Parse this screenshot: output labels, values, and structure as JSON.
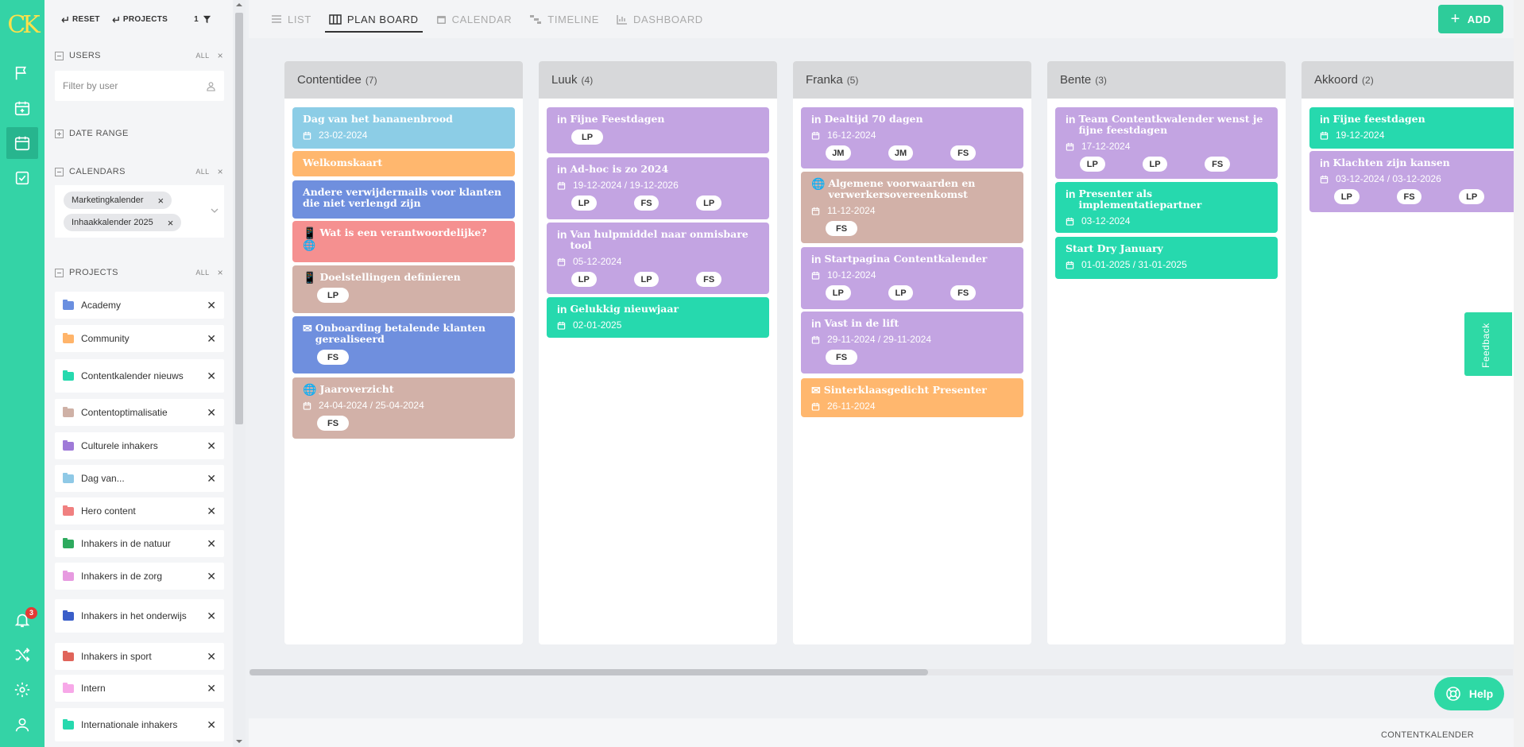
{
  "logo": {
    "text": "CK"
  },
  "rail": {
    "items": [
      {
        "name": "flag-icon"
      },
      {
        "name": "calendar-plus-icon"
      },
      {
        "name": "calendar-icon",
        "active": true
      },
      {
        "name": "check-square-icon"
      }
    ],
    "bottom": [
      {
        "name": "bell-icon",
        "badge": "3"
      },
      {
        "name": "shuffle-icon"
      },
      {
        "name": "settings-icon"
      },
      {
        "name": "user-icon"
      }
    ]
  },
  "sidebar": {
    "reset_label": "RESET",
    "projects_label": "PROJECTS",
    "filter_count": "1",
    "users": {
      "title": "USERS",
      "all": "ALL",
      "x": "×",
      "placeholder": "Filter by user"
    },
    "date_range": {
      "title": "DATE RANGE"
    },
    "calendars": {
      "title": "CALENDARS",
      "all": "ALL",
      "x": "×",
      "chips": [
        "Marketingkalender",
        "Inhaakkalender 2025"
      ],
      "chip_x": "×"
    },
    "projects": {
      "title": "PROJECTS",
      "all": "ALL",
      "x": "×",
      "items": [
        {
          "label": "Academy",
          "color": "#6a8fe0"
        },
        {
          "label": "Community",
          "color": "#ffb46a"
        },
        {
          "label": "Contentkalender nieuws",
          "color": "#26d9ae"
        },
        {
          "label": "Contentoptimalisatie",
          "color": "#cfb1a6"
        },
        {
          "label": "Culturele inhakers",
          "color": "#9f7ad8"
        },
        {
          "label": "Dag van...",
          "color": "#8fc9e6"
        },
        {
          "label": "Hero content",
          "color": "#f08080"
        },
        {
          "label": "Inhakers in de natuur",
          "color": "#2eaa5e"
        },
        {
          "label": "Inhakers in de zorg",
          "color": "#e79ae0"
        },
        {
          "label": "Inhakers in het onderwijs",
          "color": "#3a5ec9"
        },
        {
          "label": "Inhakers in sport",
          "color": "#e0645a"
        },
        {
          "label": "Intern",
          "color": "#f7a8e8"
        },
        {
          "label": "Internationale inhakers",
          "color": "#26d9ae"
        }
      ]
    }
  },
  "nav": {
    "tabs": [
      {
        "label": "LIST",
        "icon": "list-icon",
        "active": false
      },
      {
        "label": "PLAN BOARD",
        "icon": "columns-icon",
        "active": true
      },
      {
        "label": "CALENDAR",
        "icon": "calendar-icon",
        "active": false
      },
      {
        "label": "TIMELINE",
        "icon": "timeline-icon",
        "active": false
      },
      {
        "label": "DASHBOARD",
        "icon": "chart-icon",
        "active": false
      }
    ],
    "add_label": "ADD"
  },
  "board": {
    "columns": [
      {
        "title": "Contentidee",
        "count": "(7)",
        "cards": [
          {
            "title": "Dag van het bananenbrood",
            "icon": "",
            "date": "23-02-2024",
            "users": [],
            "color": "#8ccde6"
          },
          {
            "title": "Welkomskaart",
            "icon": "",
            "date": "",
            "users": [],
            "color": "#ffb76e"
          },
          {
            "title": "Andere verwijdermails voor klanten die niet verlengd zijn",
            "icon": "",
            "date": "",
            "users": [],
            "color": "#6f8fde"
          },
          {
            "title": "Wat is een verantwoordelijke?",
            "icon": "📱",
            "extra_icon": "🌐",
            "date": "",
            "users": [],
            "color": "#f59090"
          },
          {
            "title": "Doelstellingen definieren",
            "icon": "📱",
            "date": "",
            "users": [
              "LP"
            ],
            "color": "#d2b1a8"
          },
          {
            "title": "Onboarding betalende klanten gerealiseerd",
            "icon": "✉",
            "date": "",
            "users": [
              "FS"
            ],
            "color": "#6f8fde"
          },
          {
            "title": "Jaaroverzicht",
            "icon": "🌐",
            "date": "24-04-2024 / 25-04-2024",
            "users": [
              "FS"
            ],
            "color": "#d2b1a8"
          }
        ]
      },
      {
        "title": "Luuk",
        "count": "(4)",
        "cards": [
          {
            "title": "Fijne Feestdagen",
            "icon": "in",
            "date": "",
            "users": [
              "LP"
            ],
            "color": "#c3a4e2"
          },
          {
            "title": "Ad-hoc is zo 2024",
            "icon": "in",
            "date": "19-12-2024 / 19-12-2026",
            "users": [
              "LP",
              "FS",
              "LP"
            ],
            "color": "#c3a4e2"
          },
          {
            "title": "Van hulpmiddel naar onmisbare tool",
            "icon": "in",
            "date": "05-12-2024",
            "users": [
              "LP",
              "LP",
              "FS"
            ],
            "color": "#c3a4e2"
          },
          {
            "title": "Gelukkig nieuwjaar",
            "icon": "in",
            "date": "02-01-2025",
            "users": [],
            "color": "#26d9ae"
          }
        ]
      },
      {
        "title": "Franka",
        "count": "(5)",
        "cards": [
          {
            "title": "Dealtijd 70 dagen",
            "icon": "in",
            "date": "16-12-2024",
            "users": [
              "JM",
              "JM",
              "FS"
            ],
            "color": "#c3a4e2"
          },
          {
            "title": "Algemene voorwaarden en verwerkersovereenkomst",
            "icon": "🌐",
            "date": "11-12-2024",
            "users": [
              "FS"
            ],
            "color": "#d2b1a8"
          },
          {
            "title": "Startpagina Contentkalender",
            "icon": "in",
            "date": "10-12-2024",
            "users": [
              "LP",
              "LP",
              "FS"
            ],
            "color": "#c3a4e2"
          },
          {
            "title": "Vast in de lift",
            "icon": "in",
            "date": "29-11-2024 / 29-11-2024",
            "users": [
              "FS"
            ],
            "color": "#c3a4e2"
          },
          {
            "title": "Sinterklaasgedicht Presenter",
            "icon": "✉",
            "date": "26-11-2024",
            "users": [],
            "color": "#ffb76e"
          }
        ]
      },
      {
        "title": "Bente",
        "count": "(3)",
        "cards": [
          {
            "title": "Team Contentkwalender wenst je fijne feestdagen",
            "icon": "in",
            "date": "17-12-2024",
            "users": [
              "LP",
              "LP",
              "FS"
            ],
            "color": "#c3a4e2"
          },
          {
            "title": "Presenter als implementatiepartner",
            "icon": "in",
            "date": "03-12-2024",
            "users": [],
            "color": "#26d9ae"
          },
          {
            "title": "Start Dry January",
            "icon": "",
            "date": "01-01-2025 / 31-01-2025",
            "users": [],
            "color": "#26d9ae"
          }
        ]
      },
      {
        "title": "Akkoord",
        "count": "(2)",
        "cards": [
          {
            "title": "Fijne feestdagen",
            "icon": "in",
            "date": "19-12-2024",
            "users": [],
            "color": "#26d9ae"
          },
          {
            "title": "Klachten zijn kansen",
            "icon": "in",
            "date": "03-12-2024 / 03-12-2026",
            "users": [
              "LP",
              "FS",
              "LP"
            ],
            "color": "#c3a4e2"
          }
        ]
      }
    ]
  },
  "feedback_label": "Feedback",
  "help_label": "Help",
  "footer_label": "CONTENTKALENDER"
}
